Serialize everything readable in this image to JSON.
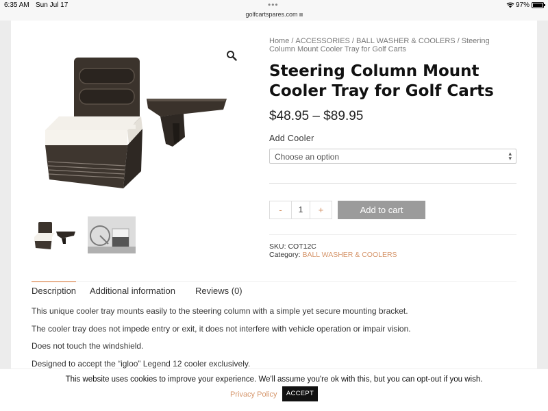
{
  "status_bar": {
    "time": "6:35 AM",
    "date": "Sun Jul 17",
    "url": "golfcartspares.com",
    "battery": "97%"
  },
  "breadcrumb": [
    "Home",
    "ACCESSORIES",
    "BALL WASHER & COOLERS",
    "Steering Column Mount Cooler Tray for Golf Carts"
  ],
  "product": {
    "title": "Steering Column Mount Cooler Tray for Golf Carts",
    "price": "$48.95 – $89.95",
    "option_label": "Add Cooler",
    "option_placeholder": "Choose an option",
    "quantity": "1",
    "minus": "-",
    "plus": "+",
    "add_to_cart": "Add to cart",
    "sku_label": "SKU:",
    "sku": "COT12C",
    "category_label": "Category:",
    "category": "BALL WASHER & COOLERS"
  },
  "tabs": [
    "Description",
    "Additional information",
    "Reviews (0)"
  ],
  "description": [
    "This unique cooler tray mounts easily to the steering column with a simple yet secure mounting bracket.",
    "The cooler tray does not impede entry or exit, it does not interfere with vehicle operation or impair vision.",
    "Does not touch the windshield.",
    "Designed to accept the “igloo” Legend 12 cooler exclusively."
  ],
  "cookie": {
    "message": "This website uses cookies to improve your experience. We'll assume you're ok with this, but you can opt-out if you wish.",
    "policy": "Privacy Policy",
    "accept": "ACCEPT"
  },
  "colors": {
    "accent": "#d5956a",
    "button": "#9b9b9b"
  }
}
